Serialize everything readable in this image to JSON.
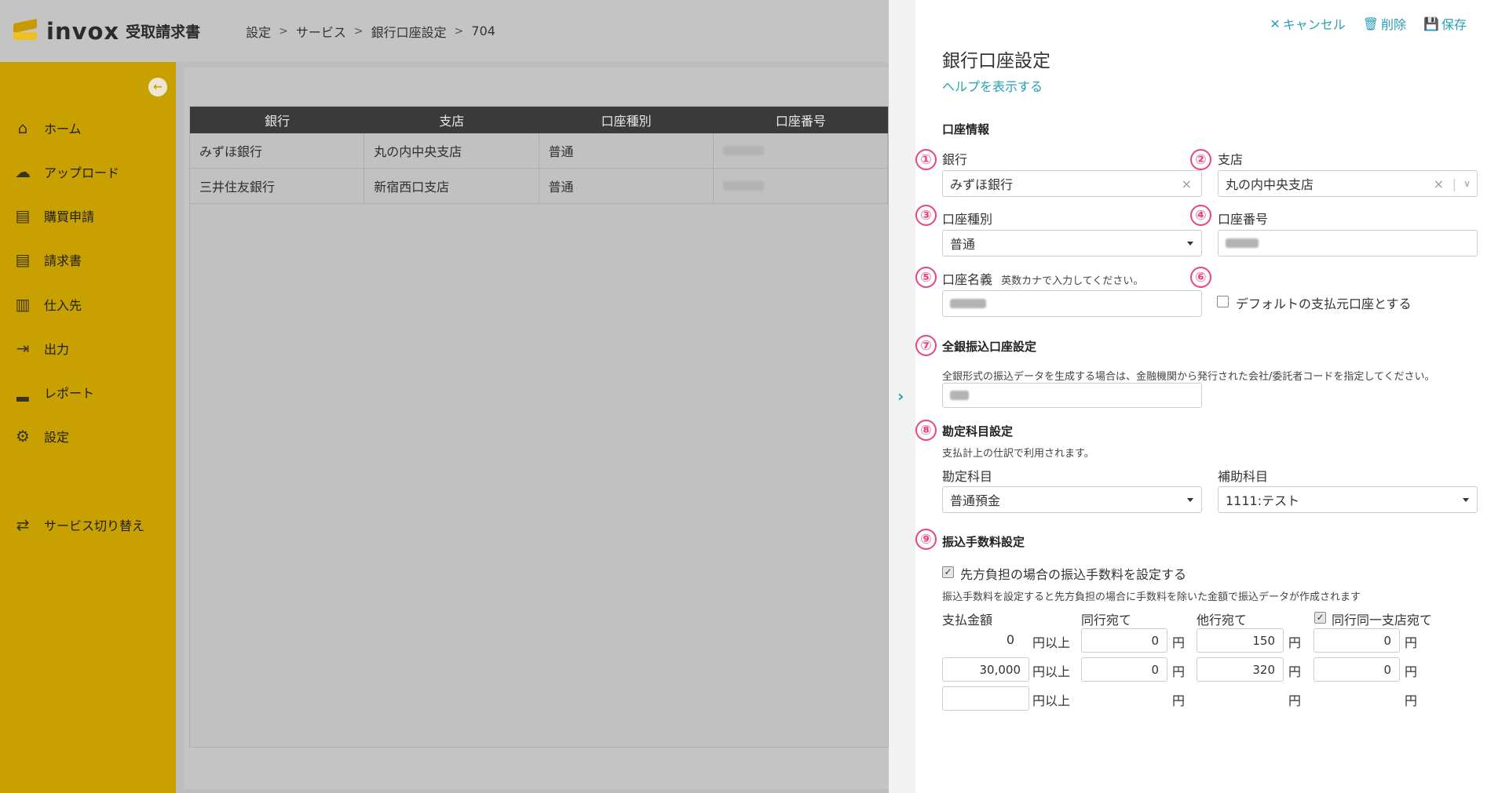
{
  "header": {
    "logo_text": "invox",
    "logo_sub": "受取請求書",
    "breadcrumb": [
      "設定",
      "サービス",
      "銀行口座設定",
      "704"
    ]
  },
  "sidebar": {
    "items": [
      {
        "label": "ホーム",
        "icon": "home-icon",
        "glyph": "⌂"
      },
      {
        "label": "アップロード",
        "icon": "cloud-upload-icon",
        "glyph": "☁"
      },
      {
        "label": "購買申請",
        "icon": "document-icon",
        "glyph": "▤"
      },
      {
        "label": "請求書",
        "icon": "invoice-icon",
        "glyph": "▤"
      },
      {
        "label": "仕入先",
        "icon": "building-icon",
        "glyph": "▥"
      },
      {
        "label": "出力",
        "icon": "export-icon",
        "glyph": "⇥"
      },
      {
        "label": "レポート",
        "icon": "chart-icon",
        "glyph": "▂"
      },
      {
        "label": "設定",
        "icon": "gear-icon",
        "glyph": "⚙"
      }
    ],
    "switch_label": "サービス切り替え",
    "switch_glyph": "⇄"
  },
  "table": {
    "columns": [
      "銀行",
      "支店",
      "口座種別",
      "口座番号"
    ],
    "rows": [
      {
        "bank": "みずほ銀行",
        "branch": "丸の内中央支店",
        "type": "普通"
      },
      {
        "bank": "三井住友銀行",
        "branch": "新宿西口支店",
        "type": "普通"
      }
    ]
  },
  "panel": {
    "actions": {
      "cancel": "キャンセル",
      "delete": "削除",
      "save": "保存"
    },
    "title": "銀行口座設定",
    "help_link": "ヘルプを表示する",
    "account_section": "口座情報",
    "bank_label": "銀行",
    "bank_value": "みずほ銀行",
    "branch_label": "支店",
    "branch_value": "丸の内中央支店",
    "type_label": "口座種別",
    "type_value": "普通",
    "number_label": "口座番号",
    "holder_label": "口座名義",
    "holder_hint": "英数カナで入力してください。",
    "default_label": "デフォルトの支払元口座とする",
    "zengin_section": "全銀振込口座設定",
    "zengin_note": "全銀形式の振込データを生成する場合は、金融機関から発行された会社/委託者コードを指定してください。",
    "account_subject_section": "勘定科目設定",
    "account_subject_note": "支払計上の仕訳で利用されます。",
    "subject_label": "勘定科目",
    "subject_value": "普通預金",
    "sub_subject_label": "補助科目",
    "sub_subject_value": "1111:テスト",
    "fee_section": "振込手数料設定",
    "fee_checkbox_label": "先方負担の場合の振込手数料を設定する",
    "fee_note": "振込手数料を設定すると先方負担の場合に手数料を除いた金額で振込データが作成されます",
    "fee_headers": {
      "amount": "支払金額",
      "same_bank": "同行宛て",
      "other_bank": "他行宛て",
      "same_branch": "同行同一支店宛て"
    },
    "unit_over": "円以上",
    "unit_yen": "円",
    "fee_rows": [
      {
        "amount": "0",
        "same_bank": "0",
        "other_bank": "150",
        "same_branch": "0"
      },
      {
        "amount": "30,000",
        "same_bank": "0",
        "other_bank": "320",
        "same_branch": "0"
      },
      {
        "amount": "",
        "same_bank": "",
        "other_bank": "",
        "same_branch": ""
      }
    ],
    "badges": [
      "①",
      "②",
      "③",
      "④",
      "⑤",
      "⑥",
      "⑦",
      "⑧",
      "⑨"
    ]
  },
  "colors": {
    "sidebar": "#c8a000",
    "accent": "#2aa0b4",
    "badge": "#e8457c"
  }
}
